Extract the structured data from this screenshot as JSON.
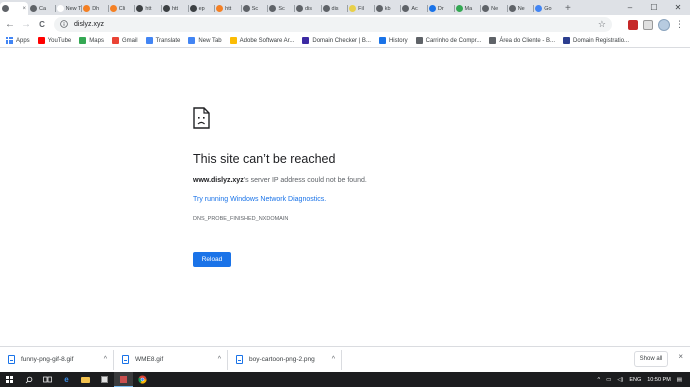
{
  "tabs": [
    {
      "label": "",
      "color": "#5f6368",
      "active": true
    },
    {
      "label": "Ca",
      "color": "#5f6368"
    },
    {
      "label": "New T",
      "color": "#ffffff"
    },
    {
      "label": "Dh",
      "color": "#f48024"
    },
    {
      "label": "Cli",
      "color": "#f48024"
    },
    {
      "label": "htt",
      "color": "#3c4043"
    },
    {
      "label": "htt",
      "color": "#3c4043"
    },
    {
      "label": "ep",
      "color": "#3c4043"
    },
    {
      "label": "htt",
      "color": "#f48024"
    },
    {
      "label": "Sc",
      "color": "#5f6368"
    },
    {
      "label": "Sc",
      "color": "#5f6368"
    },
    {
      "label": "dis",
      "color": "#5f6368"
    },
    {
      "label": "dis",
      "color": "#5f6368"
    },
    {
      "label": "Fil",
      "color": "#e8d04a"
    },
    {
      "label": "kb",
      "color": "#5f6368"
    },
    {
      "label": "Ac",
      "color": "#5f6368"
    },
    {
      "label": "Dr",
      "color": "#1a73e8"
    },
    {
      "label": "Ma",
      "color": "#34a853"
    },
    {
      "label": "Ne",
      "color": "#5f6368"
    },
    {
      "label": "Ne",
      "color": "#5f6368"
    },
    {
      "label": "Go",
      "color": "#4285f4"
    }
  ],
  "tab_close": "×",
  "new_tab": "+",
  "window": {
    "minimize": "–",
    "maximize": "☐",
    "close": "✕"
  },
  "toolbar": {
    "back": "←",
    "forward": "→",
    "reload": "C",
    "url": "dislyz.xyz",
    "star": "☆",
    "menu": "⋮"
  },
  "bookmarks": [
    {
      "label": "Apps",
      "icon": "apps-grid-icon",
      "color": "#4285f4"
    },
    {
      "label": "YouTube",
      "icon": "youtube-icon",
      "color": "#ff0000"
    },
    {
      "label": "Maps",
      "icon": "maps-icon",
      "color": "#34a853"
    },
    {
      "label": "Gmail",
      "icon": "gmail-icon",
      "color": "#ea4335"
    },
    {
      "label": "Translate",
      "icon": "translate-icon",
      "color": "#4285f4"
    },
    {
      "label": "New Tab",
      "icon": "google-icon",
      "color": "#4285f4"
    },
    {
      "label": "Adobe Software Ar...",
      "icon": "chrome-icon",
      "color": "#fbbc05"
    },
    {
      "label": "Domain Checker | B...",
      "icon": "namecheap-icon",
      "color": "#3c2aa3"
    },
    {
      "label": "History",
      "icon": "history-icon",
      "color": "#1a73e8"
    },
    {
      "label": "Carrinho de Compr...",
      "icon": "bookmark-icon",
      "color": "#5f6368"
    },
    {
      "label": "Área do Cliente - B...",
      "icon": "bookmark-icon",
      "color": "#5f6368"
    },
    {
      "label": "Domain Registratio...",
      "icon": "domain-icon",
      "color": "#2c3e8f"
    }
  ],
  "error": {
    "title": "This site can’t be reached",
    "domain": "www.dislyz.xyz",
    "desc_rest": "’s server IP address could not be found.",
    "link": "Try running Windows Network Diagnostics.",
    "code": "DNS_PROBE_FINISHED_NXDOMAIN",
    "reload": "Reload"
  },
  "downloads": [
    {
      "name": "funny-png-gif-8.gif"
    },
    {
      "name": "WME8.gif"
    },
    {
      "name": "boy-cartoon-png-2.png"
    }
  ],
  "chevron": "^",
  "show_all": "Show all",
  "shelf_close": "×",
  "taskbar": {
    "apps": [
      "windows-start",
      "search",
      "task-view",
      "edge",
      "file-explorer",
      "store",
      "photos",
      "chrome"
    ],
    "lang": "ENG",
    "time": "10:50 PM"
  }
}
